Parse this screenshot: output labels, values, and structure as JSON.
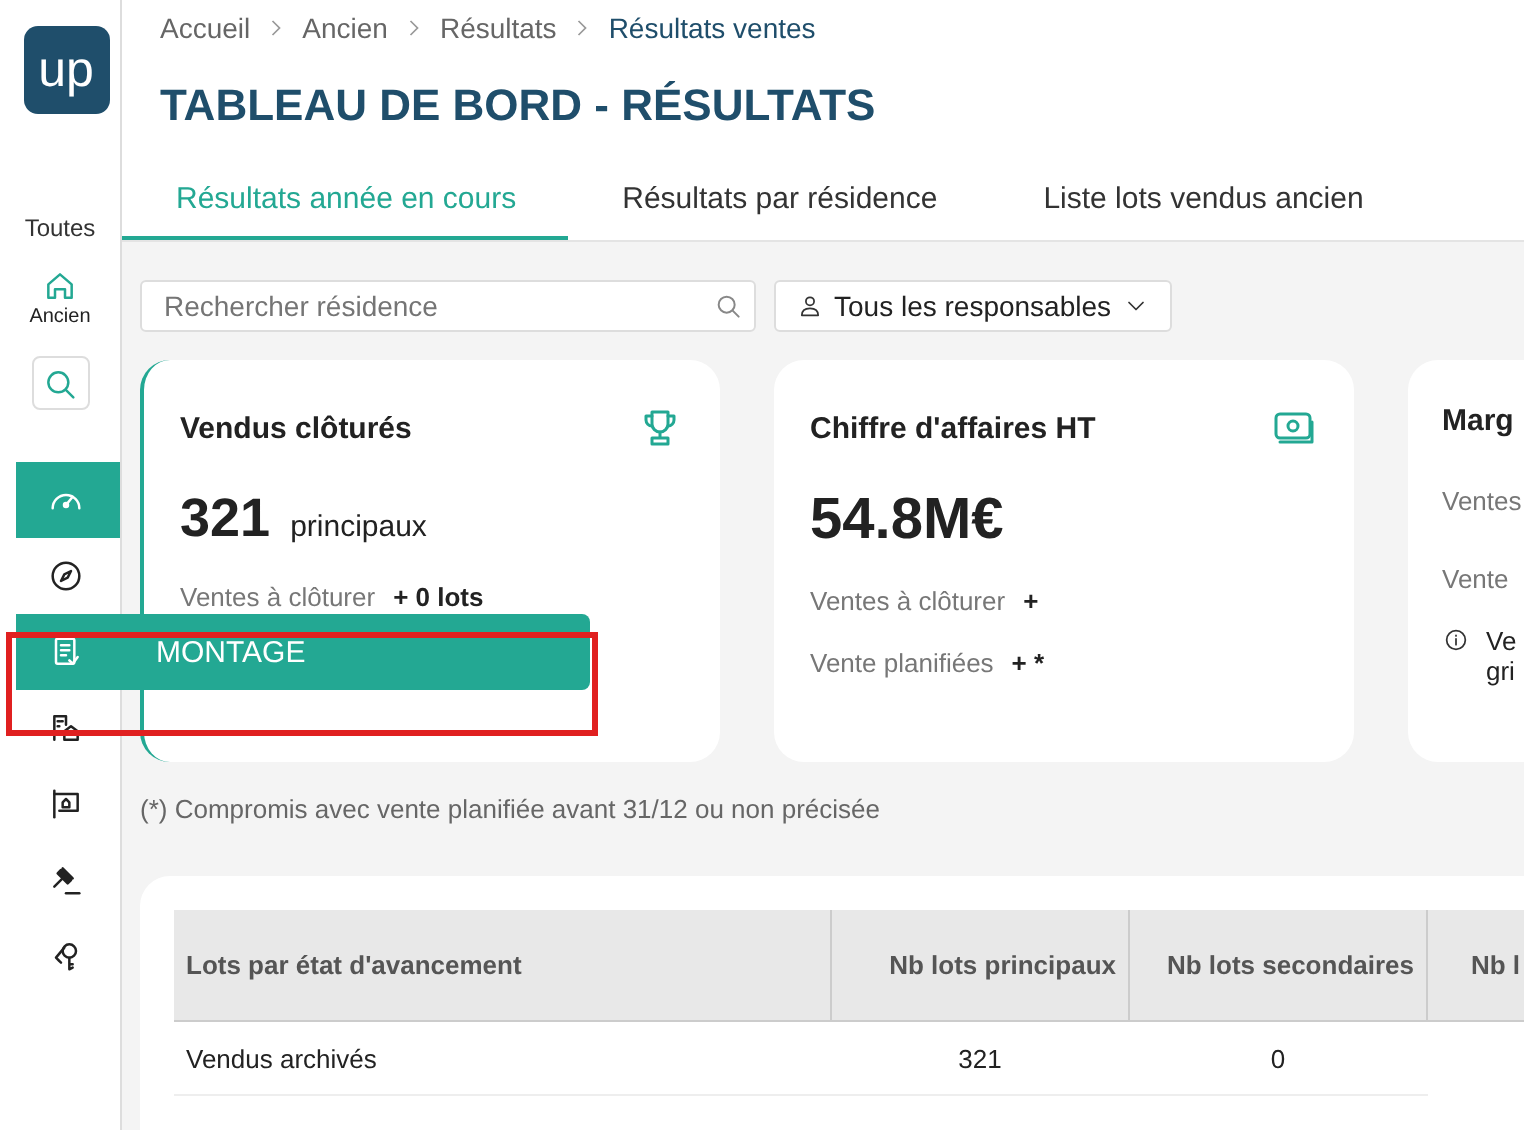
{
  "sidebar": {
    "logo": "up",
    "scope": "Toutes",
    "home": {
      "label": "Ancien"
    },
    "items": [
      {
        "kind": "gauge",
        "selected": true,
        "hovered": false
      },
      {
        "kind": "compass",
        "selected": false,
        "hovered": false
      },
      {
        "kind": "checklist",
        "selected": false,
        "hovered": true,
        "tooltip": "MONTAGE"
      },
      {
        "kind": "buildings",
        "selected": false,
        "hovered": false
      },
      {
        "kind": "sign",
        "selected": false,
        "hovered": false
      },
      {
        "kind": "gavel",
        "selected": false,
        "hovered": false
      },
      {
        "kind": "keys",
        "selected": false,
        "hovered": false
      }
    ]
  },
  "breadcrumb": [
    "Accueil",
    "Ancien",
    "Résultats",
    "Résultats ventes"
  ],
  "title": "TABLEAU DE BORD - RÉSULTATS",
  "tabs": [
    {
      "label": "Résultats année en cours",
      "selected": true
    },
    {
      "label": "Résultats par résidence",
      "selected": false
    },
    {
      "label": "Liste lots vendus ancien",
      "selected": false
    }
  ],
  "search": {
    "placeholder": "Rechercher résidence"
  },
  "filter": {
    "label": "Tous les responsables"
  },
  "cards": [
    {
      "title": "Vendus clôturés",
      "kind": "trophy",
      "value": "321",
      "unit": "principaux",
      "lines": [
        {
          "label": "Ventes à clôturer",
          "value": "+ 0 lots"
        }
      ],
      "accent": true
    },
    {
      "title": "Chiffre d'affaires HT",
      "kind": "money",
      "value": "54.8M€",
      "lines": [
        {
          "label": "Ventes à clôturer",
          "value": "+"
        },
        {
          "label": "Vente planifiées",
          "value": "+ *"
        }
      ],
      "accent": false
    },
    {
      "title": "Marg",
      "lines": [
        {
          "label": "Ventes"
        },
        {
          "label": "Vente"
        }
      ],
      "info": [
        "Ve",
        "gri"
      ],
      "accent": false
    }
  ],
  "footnote": "(*) Compromis avec vente planifiée avant 31/12 ou non précisée",
  "table": {
    "columns": [
      "Lots par état d'avancement",
      "Nb lots principaux",
      "Nb lots secondaires",
      "Nb l"
    ],
    "rows": [
      [
        "Vendus archivés",
        "321",
        "0"
      ]
    ]
  },
  "highlight": true
}
